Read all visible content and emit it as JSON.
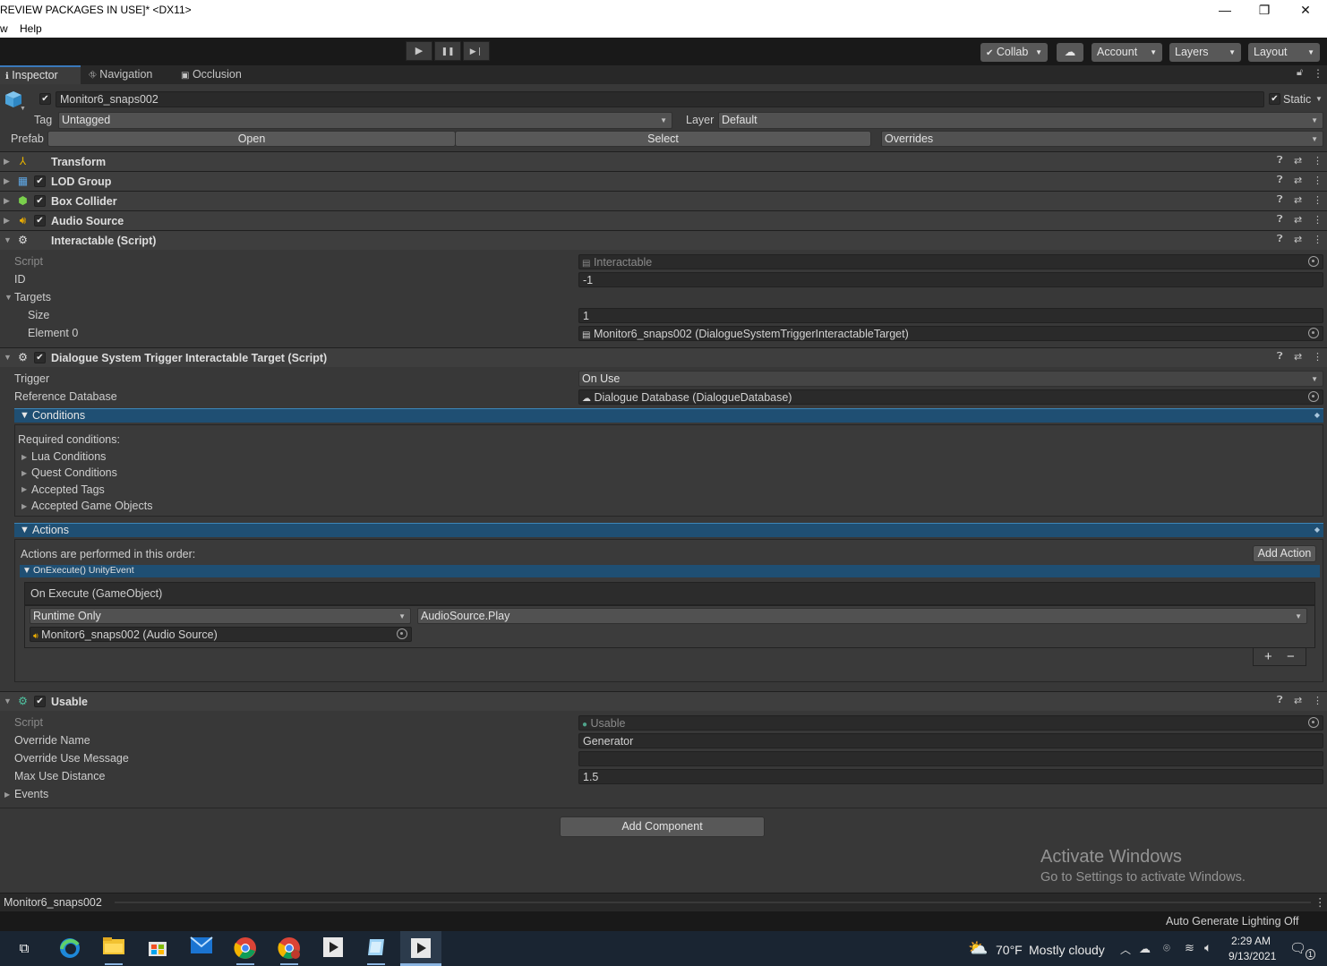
{
  "window": {
    "title": "REVIEW PACKAGES IN USE]* <DX11>",
    "minimize": "—",
    "maximize": "❐",
    "close": "✕"
  },
  "menu": {
    "items": [
      "w",
      "Help"
    ]
  },
  "toolbar": {
    "play": "▶",
    "pause": "❚❚",
    "step": "▶❘",
    "collab": "Collab",
    "cloud": "☁",
    "account": "Account",
    "layers": "Layers",
    "layout": "Layout"
  },
  "tabs": [
    {
      "icon": "ℹ",
      "label": "Inspector"
    },
    {
      "icon": "⛗",
      "label": "Navigation"
    },
    {
      "icon": "▣",
      "label": "Occlusion"
    }
  ],
  "header": {
    "object_name": "Monitor6_snaps002",
    "static_label": "Static",
    "tag_label": "Tag",
    "tag_value": "Untagged",
    "layer_label": "Layer",
    "layer_value": "Default",
    "prefab_label": "Prefab",
    "open_label": "Open",
    "select_label": "Select",
    "overrides_label": "Overrides"
  },
  "components": {
    "transform": "Transform",
    "lod_group": "LOD Group",
    "box_collider": "Box Collider",
    "audio_source": "Audio Source",
    "interactable": "Interactable (Script)",
    "dialogue_trigger": "Dialogue System Trigger Interactable Target (Script)",
    "usable": "Usable"
  },
  "interactable": {
    "script_label": "Script",
    "script_value": "Interactable",
    "id_label": "ID",
    "id_value": "-1",
    "targets_label": "Targets",
    "size_label": "Size",
    "size_value": "1",
    "element0_label": "Element 0",
    "element0_value": "Monitor6_snaps002 (DialogueSystemTriggerInteractableTarget)"
  },
  "dialogue": {
    "trigger_label": "Trigger",
    "trigger_value": "On Use",
    "refdb_label": "Reference Database",
    "refdb_value": "Dialogue Database (DialogueDatabase)",
    "conditions_label": "Conditions",
    "required_label": "Required conditions:",
    "condition_items": [
      "Lua Conditions",
      "Quest Conditions",
      "Accepted Tags",
      "Accepted Game Objects"
    ],
    "actions_label": "Actions",
    "actions_order": "Actions are performed in this order:",
    "add_action": "Add Action",
    "onexecute_label": "OnExecute() UnityEvent",
    "onexecute_header": "On Execute (GameObject)",
    "runtime_value": "Runtime Only",
    "function_value": "AudioSource.Play",
    "target_value": "Monitor6_snaps002 (Audio Source)",
    "plus": "+",
    "minus": "−"
  },
  "usable": {
    "script_label": "Script",
    "script_value": "Usable",
    "override_name_label": "Override Name",
    "override_name_value": "Generator",
    "override_msg_label": "Override Use Message",
    "override_msg_value": "",
    "max_dist_label": "Max Use Distance",
    "max_dist_value": "1.5",
    "events_label": "Events"
  },
  "add_component": "Add Component",
  "activate": {
    "title": "Activate Windows",
    "subtitle": "Go to Settings to activate Windows."
  },
  "status": {
    "object": "Monitor6_snaps002",
    "lighting": "Auto Generate Lighting Off"
  },
  "taskbar": {
    "weather_temp": "70°F",
    "weather_desc": "Mostly cloudy",
    "time": "2:29 AM",
    "date": "9/13/2021",
    "notif_count": "1"
  },
  "colors": {
    "accent": "#3a79bb",
    "section_blue": "#1f4f73",
    "panel": "#383838"
  }
}
